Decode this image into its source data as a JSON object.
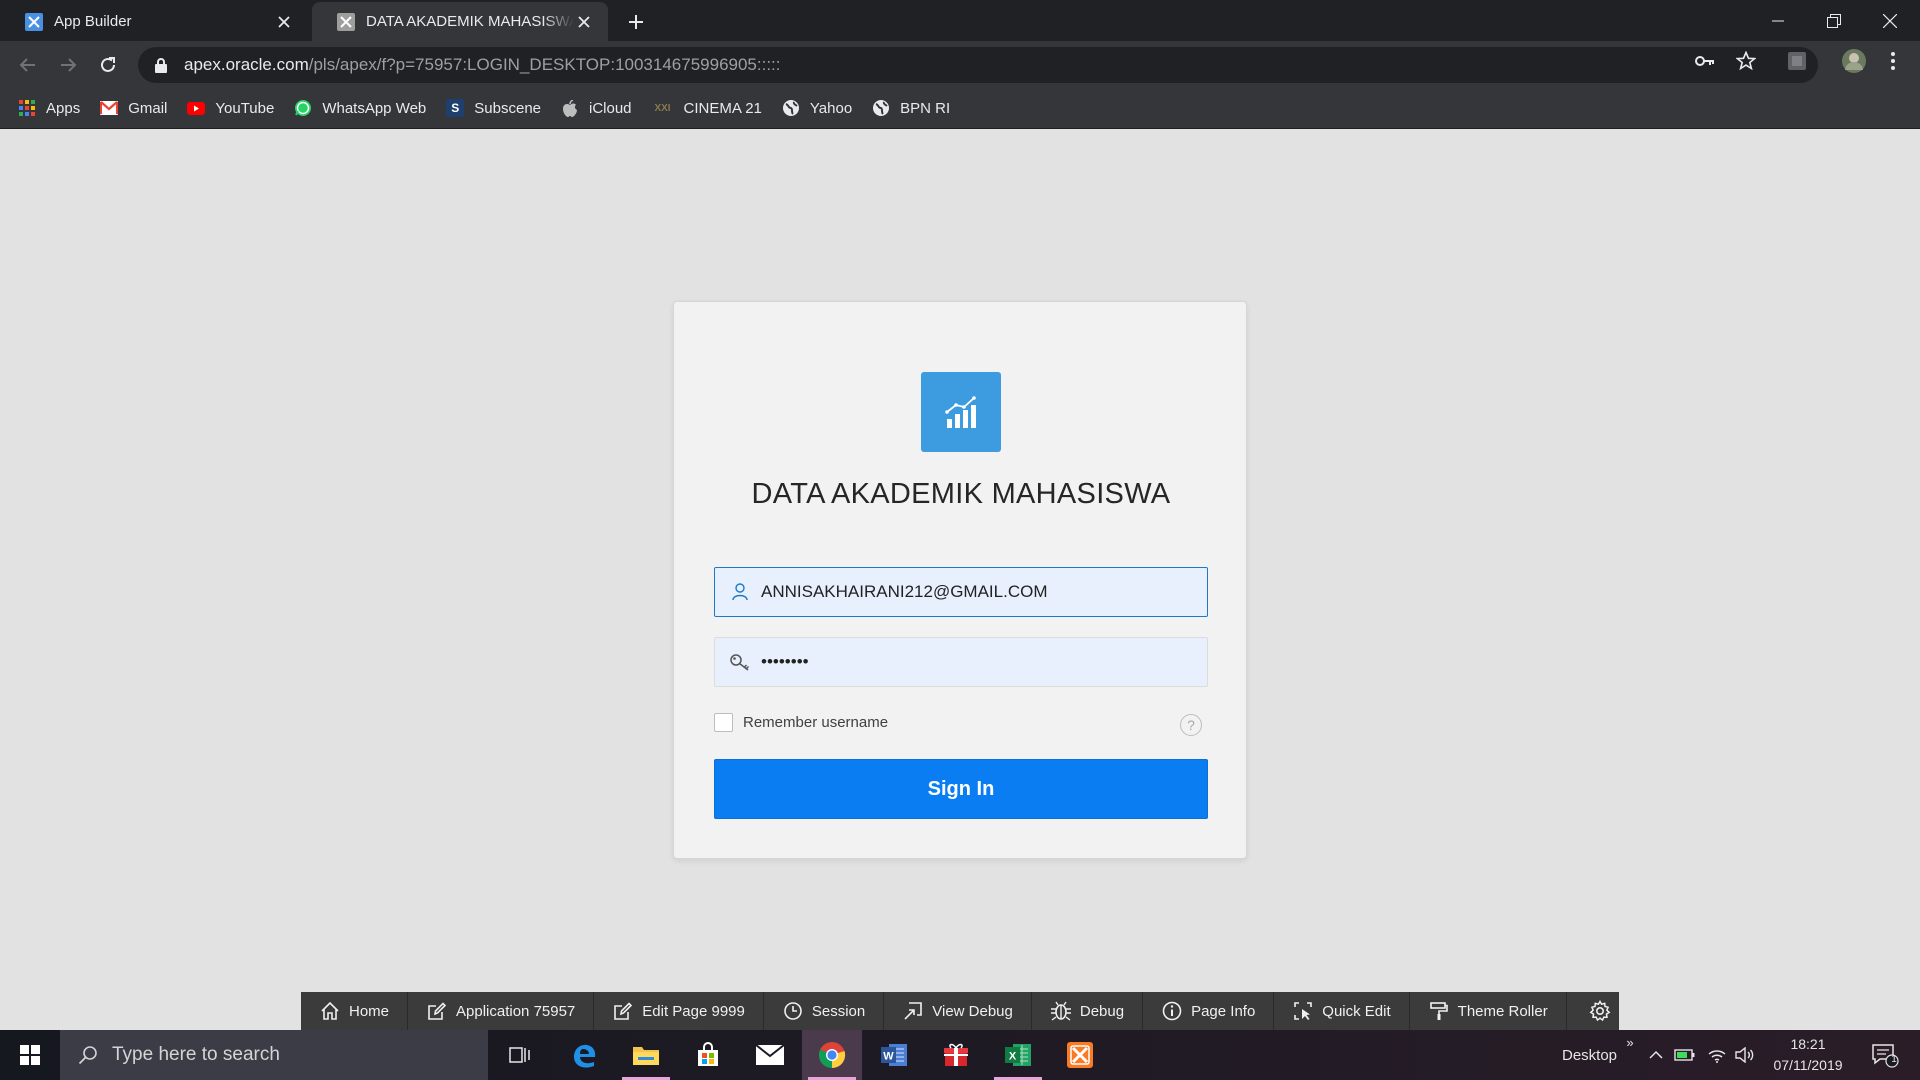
{
  "browser": {
    "tabs": [
      {
        "title": "App Builder",
        "active": false,
        "favicon": "apex-app-builder-icon"
      },
      {
        "title": "DATA AKADEMIK MAHASISWA - ",
        "active": true,
        "favicon": "apex-app-icon"
      }
    ],
    "url_host": "apex.oracle.com",
    "url_path": "/pls/apex/f?p=75957:LOGIN_DESKTOP:100314675996905:::::",
    "bookmarks": [
      {
        "label": "Apps",
        "icon": "apps-grid-icon"
      },
      {
        "label": "Gmail",
        "icon": "gmail-icon"
      },
      {
        "label": "YouTube",
        "icon": "youtube-icon"
      },
      {
        "label": "WhatsApp Web",
        "icon": "whatsapp-icon"
      },
      {
        "label": "Subscene",
        "icon": "subscene-icon"
      },
      {
        "label": "iCloud",
        "icon": "apple-icon"
      },
      {
        "label": "CINEMA 21",
        "icon": "xxi-icon"
      },
      {
        "label": "Yahoo",
        "icon": "globe-icon"
      },
      {
        "label": "BPN RI",
        "icon": "globe-icon"
      }
    ]
  },
  "login": {
    "app_title": "DATA AKADEMIK MAHASISWA",
    "username_value": "ANNISAKHAIRANI212@GMAIL.COM",
    "password_value": "••••••••",
    "remember_label": "Remember username",
    "help_glyph": "?",
    "signin_label": "Sign In"
  },
  "dev_toolbar": [
    {
      "label": "Home",
      "icon": "home-icon"
    },
    {
      "label": "Application 75957",
      "icon": "edit-app-icon"
    },
    {
      "label": "Edit Page 9999",
      "icon": "edit-page-icon"
    },
    {
      "label": "Session",
      "icon": "clock-icon"
    },
    {
      "label": "View Debug",
      "icon": "view-debug-icon"
    },
    {
      "label": "Debug",
      "icon": "bug-icon"
    },
    {
      "label": "Page Info",
      "icon": "info-icon"
    },
    {
      "label": "Quick Edit",
      "icon": "quick-edit-icon"
    },
    {
      "label": "Theme Roller",
      "icon": "paint-roller-icon"
    }
  ],
  "taskbar": {
    "search_placeholder": "Type here to search",
    "desktop_label": "Desktop",
    "time": "18:21",
    "date": "07/11/2019",
    "notification_count": "1"
  },
  "colors": {
    "accent": "#0a7df2",
    "logo_bg": "#3d9be0",
    "page_bg": "#e2e2e2"
  }
}
